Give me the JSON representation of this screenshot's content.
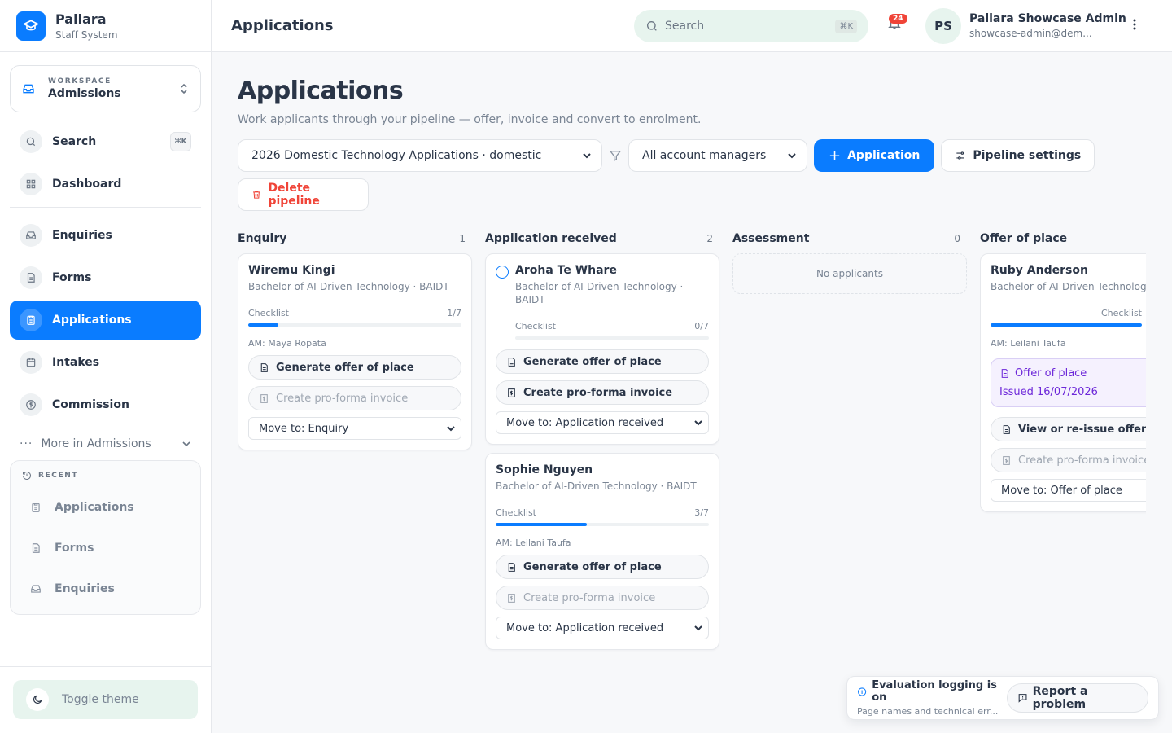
{
  "brand": {
    "name": "Pallara",
    "subtitle": "Staff System"
  },
  "workspace": {
    "label": "WORKSPACE",
    "name": "Admissions"
  },
  "nav": {
    "search": "Search",
    "search_kbd": "⌘K",
    "items": [
      {
        "label": "Dashboard",
        "icon": "grid-icon"
      },
      {
        "label": "Enquiries",
        "icon": "inbox-icon"
      },
      {
        "label": "Forms",
        "icon": "document-icon"
      },
      {
        "label": "Applications",
        "icon": "clipboard-icon",
        "active": true
      },
      {
        "label": "Intakes",
        "icon": "calendar-icon"
      },
      {
        "label": "Commission",
        "icon": "dollar-icon"
      }
    ],
    "more": "More in Admissions"
  },
  "recent": {
    "label": "RECENT",
    "items": [
      "Applications",
      "Forms",
      "Enquiries"
    ]
  },
  "toggle_theme": "Toggle theme",
  "topbar": {
    "title": "Applications",
    "search_placeholder": "Search",
    "search_kbd": "⌘K",
    "notifications": "24",
    "user": {
      "initials": "PS",
      "name": "Pallara Showcase Admin",
      "email": "showcase-admin@dem..."
    }
  },
  "page": {
    "title": "Applications",
    "subtitle": "Work applicants through your pipeline — offer, invoice and convert to enrolment."
  },
  "toolbar": {
    "pipeline": "2026 Domestic Technology Applications · domestic",
    "managers": "All account managers",
    "add": "Application",
    "settings": "Pipeline settings",
    "delete": "Delete pipeline"
  },
  "columns": [
    {
      "title": "Enquiry",
      "count": "1",
      "cards": [
        {
          "name": "Wiremu Kingi",
          "program": "Bachelor of AI-Driven Technology · BAIDT",
          "checklist": "Checklist",
          "progress": "1/7",
          "fill": 0.143,
          "am": "AM: Maya Ropata",
          "actions": [
            {
              "label": "Generate offer of place",
              "disabled": false
            },
            {
              "label": "Create pro-forma invoice",
              "disabled": true
            }
          ],
          "move": "Move to: Enquiry"
        }
      ]
    },
    {
      "title": "Application received",
      "count": "2",
      "cards": [
        {
          "name": "Aroha Te Whare",
          "program": "Bachelor of AI-Driven Technology · BAIDT",
          "checklist": "Checklist",
          "progress": "0/7",
          "fill": 0,
          "am": "",
          "actions": [
            {
              "label": "Generate offer of place",
              "disabled": false
            },
            {
              "label": "Create pro-forma invoice",
              "disabled": false
            }
          ],
          "move": "Move to: Application received"
        },
        {
          "name": "Sophie Nguyen",
          "program": "Bachelor of AI-Driven Technology · BAIDT",
          "checklist": "Checklist",
          "progress": "3/7",
          "fill": 0.429,
          "am": "AM: Leilani Taufa",
          "actions": [
            {
              "label": "Generate offer of place",
              "disabled": false
            },
            {
              "label": "Create pro-forma invoice",
              "disabled": true
            }
          ],
          "move": "Move to: Application received"
        }
      ]
    },
    {
      "title": "Assessment",
      "count": "0",
      "empty": "No applicants"
    },
    {
      "title": "Offer of place",
      "count": "",
      "cards": [
        {
          "name": "Ruby Anderson",
          "program": "Bachelor of AI-Driven Technolog",
          "checklist": "Checklist",
          "progress": "",
          "fill": 1,
          "am": "AM: Leilani Taufa",
          "offer": {
            "title": "Offer of place",
            "date": "Issued 16/07/2026"
          },
          "actions": [
            {
              "label": "View or re-issue offer",
              "disabled": false
            },
            {
              "label": "Create pro-forma invoice",
              "disabled": true
            }
          ],
          "move": "Move to: Offer of place"
        }
      ]
    }
  ],
  "toast": {
    "title": "Evaluation logging is on",
    "subtitle": "Page names and technical err...",
    "report": "Report a problem"
  },
  "colors": {
    "accent": "#0a7cff",
    "danger": "#f04438",
    "offer": "#6d28d9"
  }
}
